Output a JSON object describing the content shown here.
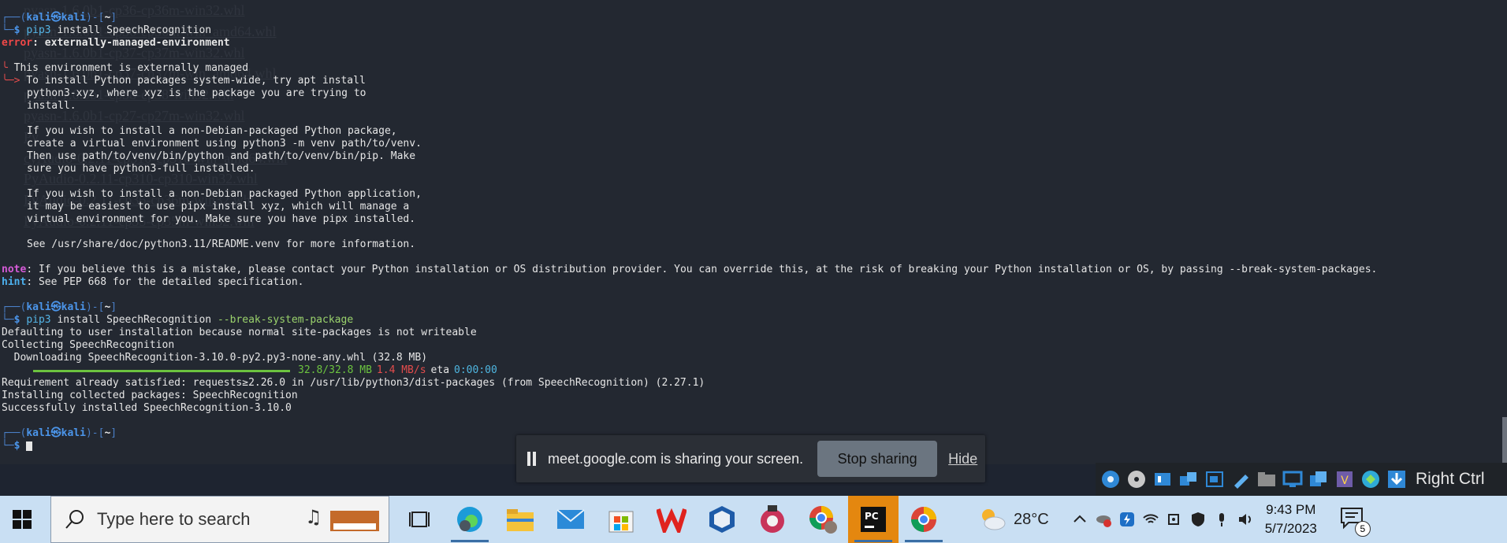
{
  "terminal": {
    "ghost_lines": [
      "pyasn-1.6.0b1-cp36-cp36m-win32.whl",
      "pyasn-1.6.0b1-cp36-cp36m-win_amd64.whl",
      "pyasn-1.6.0b1-cp37-cp37m-win32.whl",
      "pyasn-1.6.0b1-cp37-cp37m-win_amd64.whl",
      "pyasn-1.6.0b1-cp38-cp38-win32.whl",
      "pyasn-1.6.0b1-cp27-cp27m-win32.whl",
      "Py",
      "cyAudio-0.2.11-cp310-cp310-win_amd64.whl",
      "PyAudio-0.2.11-cp310-cp310-win32.whl",
      "PyAudio-0.2.11-cp36-cp36m-win32.whl",
      "PyAudio-0.2.11-cp35-cp35m-win32.whl"
    ],
    "prompt_user": "kali",
    "prompt_at": "㉿",
    "prompt_host": "kali",
    "prompt_dir": "~",
    "cmd1": "pip3",
    "cmd1_args": " install SpeechRecognition",
    "error_label": "error",
    "error_text": ": externally-managed-environment",
    "env_title": "This environment is externally managed",
    "env_lines": [
      "To install Python packages system-wide, try apt install",
      "python3-xyz, where xyz is the package you are trying to",
      "install.",
      "",
      "If you wish to install a non-Debian-packaged Python package,",
      "create a virtual environment using python3 -m venv path/to/venv.",
      "Then use path/to/venv/bin/python and path/to/venv/bin/pip. Make",
      "sure you have python3-full installed.",
      "",
      "If you wish to install a non-Debian packaged Python application,",
      "it may be easiest to use pipx install xyz, which will manage a",
      "virtual environment for you. Make sure you have pipx installed.",
      "",
      "See /usr/share/doc/python3.11/README.venv for more information."
    ],
    "note_label": "note",
    "note_text": ": If you believe this is a mistake, please contact your Python installation or OS distribution provider. You can override this, at the risk of breaking your Python installation or OS, by passing --break-system-packages.",
    "hint_label": "hint",
    "hint_text": ": See PEP 668 for the detailed specification.",
    "cmd2": "pip3",
    "cmd2_args": " install SpeechRecognition ",
    "cmd2_flag": "--break-system-package",
    "out_lines": [
      "Defaulting to user installation because normal site-packages is not writeable",
      "Collecting SpeechRecognition",
      "  Downloading SpeechRecognition-3.10.0-py2.py3-none-any.whl (32.8 MB)"
    ],
    "progress": {
      "fraction": 1.0,
      "size": "32.8/32.8 MB",
      "speed": "1.4 MB/s",
      "eta_label": "eta",
      "eta": "0:00:00"
    },
    "out_lines2": [
      "Requirement already satisfied: requests≥2.26.0 in /usr/lib/python3/dist-packages (from SpeechRecognition) (2.27.1)",
      "Installing collected packages: SpeechRecognition",
      "Successfully installed SpeechRecognition-3.10.0"
    ]
  },
  "share_bar": {
    "text": "meet.google.com is sharing your screen.",
    "stop_label": "Stop sharing",
    "hide_label": "Hide"
  },
  "vbox": {
    "host_key": "Right Ctrl"
  },
  "taskbar": {
    "search_placeholder": "Type here to search",
    "apps": [
      "task-view",
      "edge",
      "file-explorer",
      "mail",
      "microsoft-store",
      "wps-office",
      "virtualbox",
      "davinci-resolve",
      "chrome-profile",
      "pycharm",
      "chrome"
    ],
    "temperature": "28°C",
    "time": "9:43 PM",
    "date": "5/7/2023",
    "notification_count": "5"
  },
  "colors": {
    "terminal_bg": "#232831",
    "prompt_blue": "#4b95ea",
    "error_red": "#f04848",
    "taskbar_bg": "#c9dff3",
    "pycharm_active": "#e4870f"
  }
}
